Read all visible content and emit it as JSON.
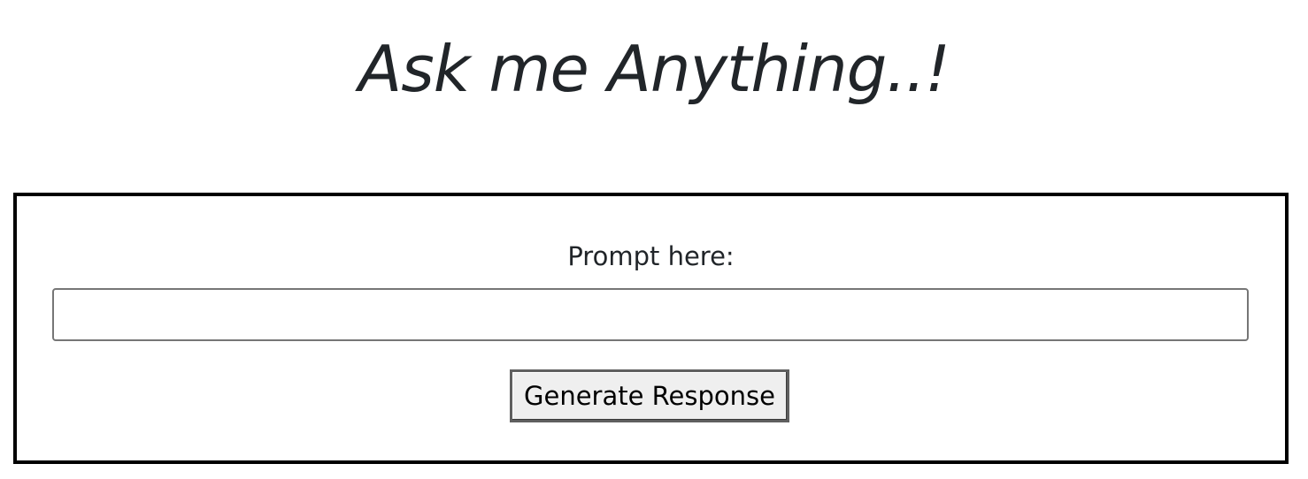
{
  "header": {
    "title": "Ask me Anything..!"
  },
  "prompt_form": {
    "label": "Prompt here:",
    "input_value": "",
    "input_placeholder": "",
    "submit_label": "Generate Response"
  }
}
